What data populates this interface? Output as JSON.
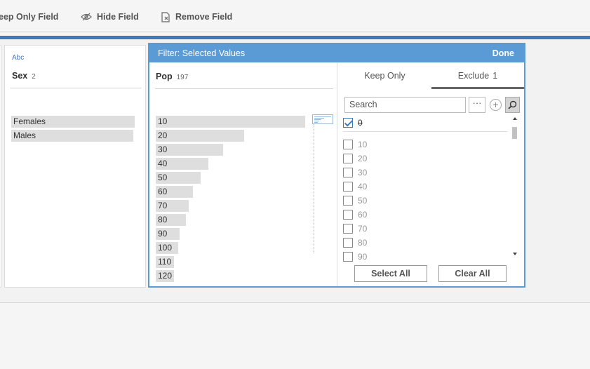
{
  "toolbar": {
    "keep_only_label": "eep Only Field",
    "hide_label": "Hide Field",
    "remove_label": "Remove Field"
  },
  "sex_card": {
    "type_tag": "Abc",
    "name": "Sex",
    "count": "2",
    "values": [
      "Females",
      "Males"
    ]
  },
  "filter": {
    "title": "Filter: Selected Values",
    "done_label": "Done",
    "pop": {
      "name": "Pop",
      "count": "197",
      "bars": [
        {
          "label": "10",
          "fraction": 1.0
        },
        {
          "label": "20",
          "fraction": 0.59
        },
        {
          "label": "30",
          "fraction": 0.45
        },
        {
          "label": "40",
          "fraction": 0.35
        },
        {
          "label": "50",
          "fraction": 0.3
        },
        {
          "label": "60",
          "fraction": 0.25
        },
        {
          "label": "70",
          "fraction": 0.22
        },
        {
          "label": "80",
          "fraction": 0.2
        },
        {
          "label": "90",
          "fraction": 0.16
        },
        {
          "label": "100",
          "fraction": 0.15
        },
        {
          "label": "110",
          "fraction": 0.12
        },
        {
          "label": "120",
          "fraction": 0.12
        }
      ]
    },
    "tabs": {
      "keep_only": "Keep Only",
      "exclude": "Exclude",
      "exclude_count": "1"
    },
    "search_placeholder": "Search",
    "more_label": "···",
    "plus_label": "+",
    "selected_value": {
      "label": "0",
      "checked": true
    },
    "list_values": [
      {
        "label": "10",
        "checked": false
      },
      {
        "label": "20",
        "checked": false
      },
      {
        "label": "30",
        "checked": false
      },
      {
        "label": "40",
        "checked": false
      },
      {
        "label": "50",
        "checked": false
      },
      {
        "label": "60",
        "checked": false
      },
      {
        "label": "70",
        "checked": false
      },
      {
        "label": "80",
        "checked": false
      },
      {
        "label": "90",
        "checked": false
      }
    ],
    "select_all_label": "Select All",
    "clear_all_label": "Clear All"
  }
}
